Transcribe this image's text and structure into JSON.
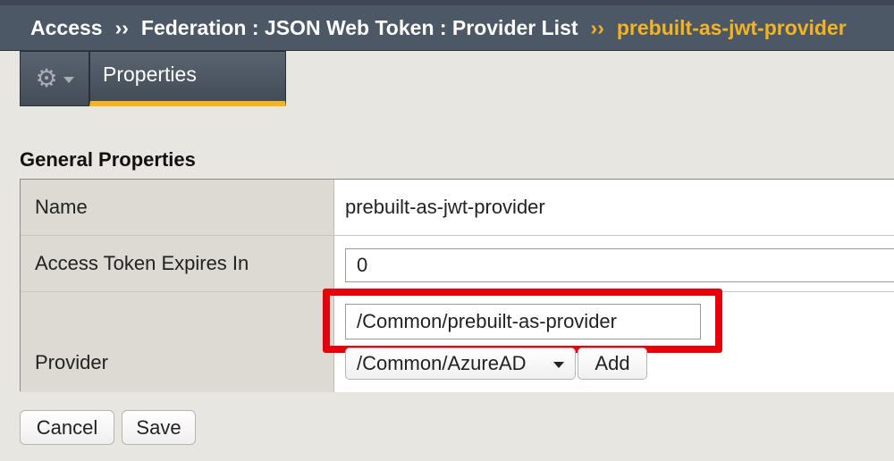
{
  "breadcrumb": {
    "items": [
      "Access",
      "Federation : JSON Web Token : Provider List"
    ],
    "current": "prebuilt-as-jwt-provider",
    "separator": "››"
  },
  "tabs": {
    "gear_icon": "gear-icon",
    "active": "Properties"
  },
  "section": {
    "title": "General Properties"
  },
  "fields": {
    "name": {
      "label": "Name",
      "value": "prebuilt-as-jwt-provider"
    },
    "access_token_expires": {
      "label": "Access Token Expires In",
      "value": "0"
    },
    "provider": {
      "label": "Provider",
      "value": "/Common/prebuilt-as-provider",
      "select_value": "/Common/AzureAD",
      "add_label": "Add"
    }
  },
  "actions": {
    "cancel_label": "Cancel",
    "save_label": "Save"
  },
  "colors": {
    "header_bg": "#4d5866",
    "accent": "#f4b321",
    "highlight": "#e8000a"
  }
}
